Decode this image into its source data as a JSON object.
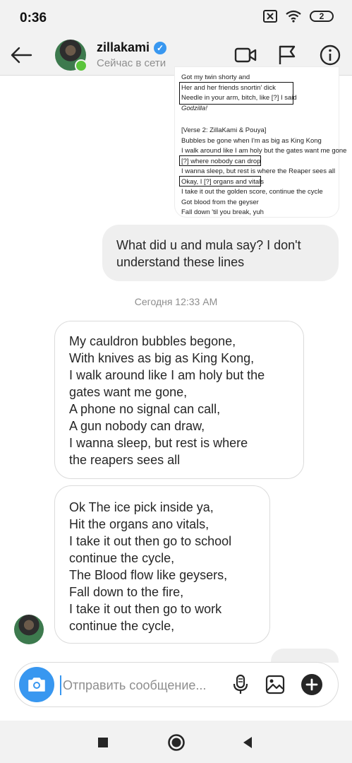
{
  "status_bar": {
    "time": "0:36",
    "battery": "2"
  },
  "header": {
    "contact_name": "zillakami",
    "contact_status": "Сейчас в сети"
  },
  "shared_image": {
    "lines": [
      "Got my twin shorty and",
      "Her and her friends snortin' dick",
      "Needle in your arm, bitch, like [?] I said",
      "Godzilla!",
      "",
      "[Verse 2: ZillaKami & Pouya]",
      "Bubbles be gone when I'm as big as King Kong",
      "I walk around like I am holy but the gates want me gone",
      "[?] where nobody can drop",
      "I wanna sleep, but rest is where the Reaper sees all",
      "Okay, I [?] organs and vitals",
      "I take it out the golden score, continue the cycle",
      "Got blood from the geyser",
      "Fall down 'til you break, yuh"
    ]
  },
  "messages": {
    "outgoing_1": "What did u and mula say? I don't\nunderstand these lines",
    "timestamp": "Сегодня 12:33 AM",
    "incoming_1": "My cauldron bubbles begone,\nWith knives as big as King Kong,\nI walk around like I am holy but the\ngates want me gone,\nA phone no signal can call,\nA gun nobody can draw,\nI wanna sleep, but rest is where\nthe reapers sees all",
    "incoming_2": "Ok The ice pick inside ya,\nHit the organs ano vitals,\nI take it out then go to school\ncontinue the cycle,\nThe Blood flow like geysers,\nFall down to the fire,\nI take it out then go to work\ncontinue the cycle,"
  },
  "composer": {
    "placeholder": "Отправить сообщение..."
  },
  "icons": {
    "back": "arrow-left-icon",
    "video": "video-camera-icon",
    "report": "flag-icon",
    "info": "info-icon",
    "camera": "camera-icon",
    "mic": "microphone-icon",
    "gallery": "image-icon",
    "add": "plus-circle-icon"
  },
  "colors": {
    "accent": "#3897f0",
    "online": "#5ac43b",
    "bubble_out": "#efefef"
  }
}
